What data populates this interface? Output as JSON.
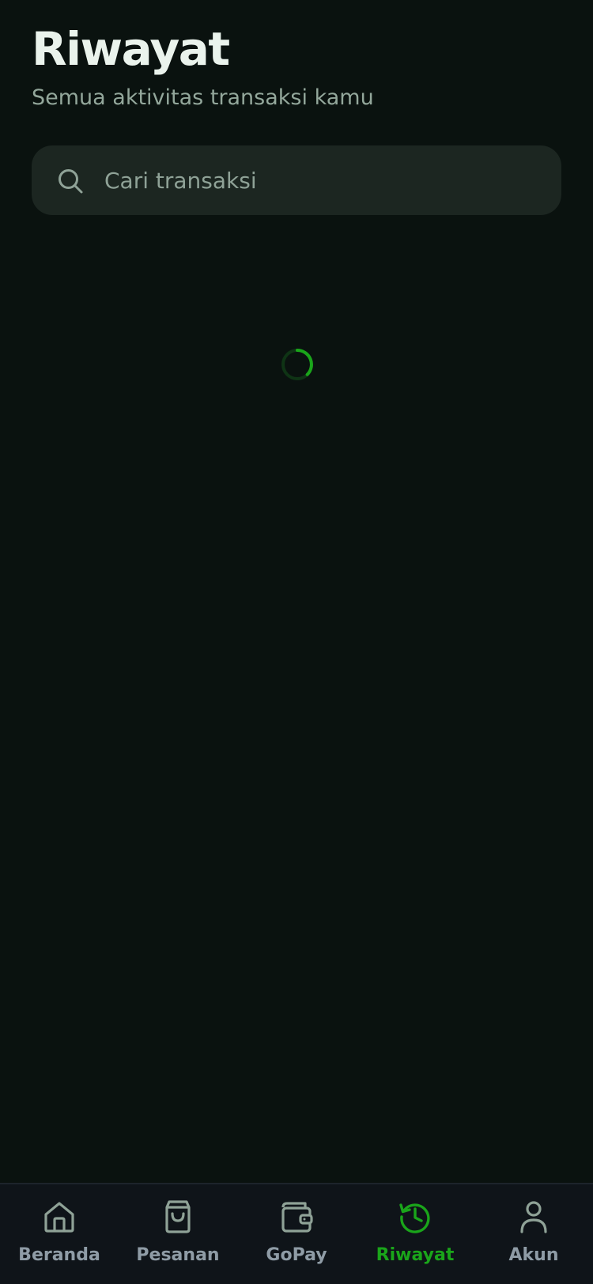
{
  "header": {
    "title": "Riwayat",
    "subtitle": "Semua aktivitas transaksi kamu"
  },
  "search": {
    "placeholder": "Cari transaksi",
    "value": "",
    "icon": "search-icon"
  },
  "loading": {
    "indicator": "spinner",
    "accent": "#1aa51a"
  },
  "nav": {
    "items": [
      {
        "label": "Beranda",
        "icon": "home-icon",
        "active": false
      },
      {
        "label": "Pesanan",
        "icon": "shopping-bag-icon",
        "active": false
      },
      {
        "label": "GoPay",
        "icon": "wallet-icon",
        "active": false
      },
      {
        "label": "Riwayat",
        "icon": "history-icon",
        "active": true
      },
      {
        "label": "Akun",
        "icon": "user-icon",
        "active": false
      }
    ]
  },
  "colors": {
    "background": "#0a120f",
    "accent": "#1aa51a",
    "nav_inactive": "#8f9ca6"
  }
}
